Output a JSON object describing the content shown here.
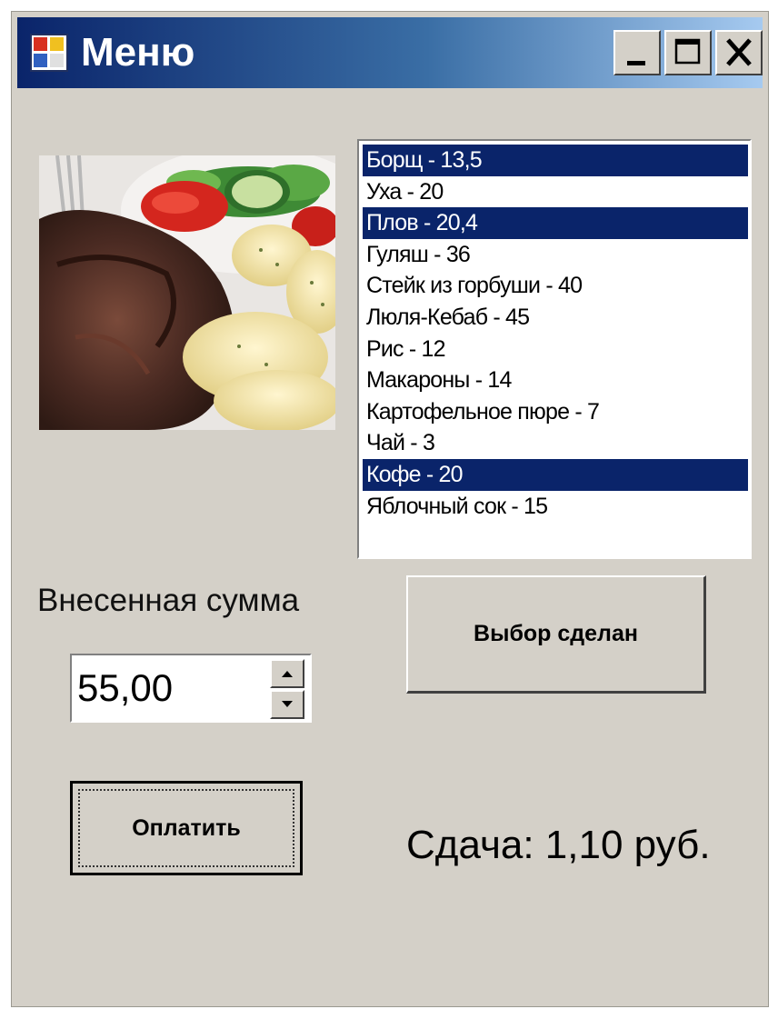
{
  "window": {
    "title": "Меню",
    "icon": "application-icon",
    "controls": [
      "minimize-icon",
      "maximize-icon",
      "close-icon"
    ]
  },
  "photo": {
    "icon": "food-photo"
  },
  "menu_list": {
    "items": [
      {
        "label": "Борщ - 13,5",
        "selected": true
      },
      {
        "label": "Уха - 20",
        "selected": false
      },
      {
        "label": "Плов - 20,4",
        "selected": true
      },
      {
        "label": "Гуляш - 36",
        "selected": false
      },
      {
        "label": "Стейк из горбуши - 40",
        "selected": false
      },
      {
        "label": "Люля-Кебаб - 45",
        "selected": false
      },
      {
        "label": "Рис - 12",
        "selected": false
      },
      {
        "label": "Макароны - 14",
        "selected": false
      },
      {
        "label": "Картофельное пюре - 7",
        "selected": false
      },
      {
        "label": "Чай - 3",
        "selected": false
      },
      {
        "label": "Кофе - 20",
        "selected": true
      },
      {
        "label": "Яблочный сок - 15",
        "selected": false
      }
    ],
    "selection_color": "#0a246a"
  },
  "payment": {
    "amount_label": "Внесенная сумма",
    "amount_value": "55,00",
    "pay_button": "Оплатить",
    "choice_button": "Выбор сделан",
    "change_text": "Сдача: 1,10 руб."
  }
}
